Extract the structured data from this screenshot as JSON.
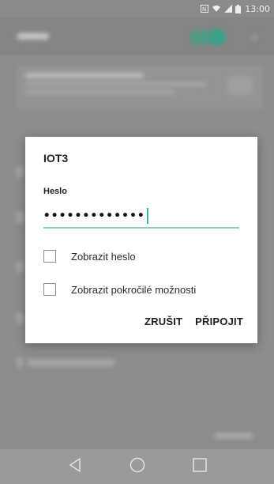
{
  "status_bar": {
    "time": "13:00",
    "icons": [
      "nfc-icon",
      "wifi-signal-icon",
      "cellular-signal-icon",
      "battery-icon"
    ]
  },
  "dialog": {
    "title": "IOT3",
    "password_label": "Heslo",
    "password_value": "•••••••••••••",
    "show_password_label": "Zobrazit heslo",
    "show_password_checked": false,
    "advanced_options_label": "Zobrazit pokročilé možnosti",
    "advanced_options_checked": false,
    "cancel_label": "ZRUŠIT",
    "connect_label": "PŘIPOJIT",
    "accent_color": "#7fd1c7"
  },
  "nav_bar": {
    "icons": [
      "back-icon",
      "home-icon",
      "recents-icon"
    ]
  }
}
